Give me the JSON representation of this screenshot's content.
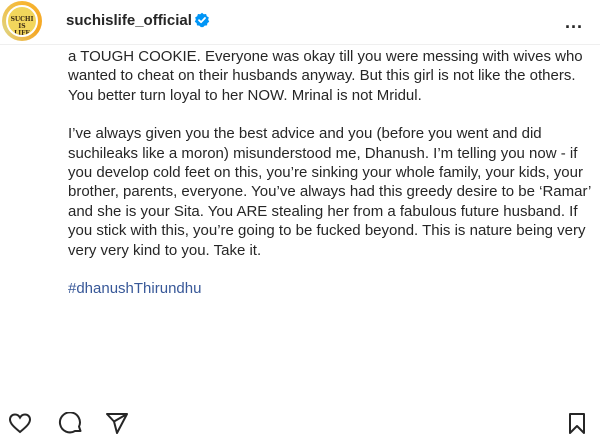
{
  "header": {
    "username": "suchislife_official",
    "avatar_text": "SUCHI IS LIFE",
    "more_label": "..."
  },
  "post": {
    "paragraph1": "a TOUGH COOKIE. Everyone was okay till you were messing with wives who wanted to cheat on their husbands anyway. But this girl is not like the others. You better turn loyal to her NOW. Mrinal is not Mridul.",
    "paragraph2": "I’ve always given you the best advice and you (before you went and did suchileaks like a moron) misunderstood me, Dhanush. I’m telling you now - if you develop cold feet on this, you’re sinking your whole family, your kids, your brother, parents, everyone. You’ve always had this greedy desire to be ‘Ramar’ and she is your Sita. You ARE stealing her from a fabulous future husband. If you stick with this, you’re going to be fucked beyond. This is nature being very very very kind to you. Take it.",
    "hashtag": "#dhanushThirundhu"
  },
  "icons": [
    "heart-icon",
    "comment-icon",
    "share-icon",
    "save-icon"
  ],
  "colors": {
    "hashtag": "#385898",
    "verified": "#0095f6",
    "text": "#262626"
  }
}
